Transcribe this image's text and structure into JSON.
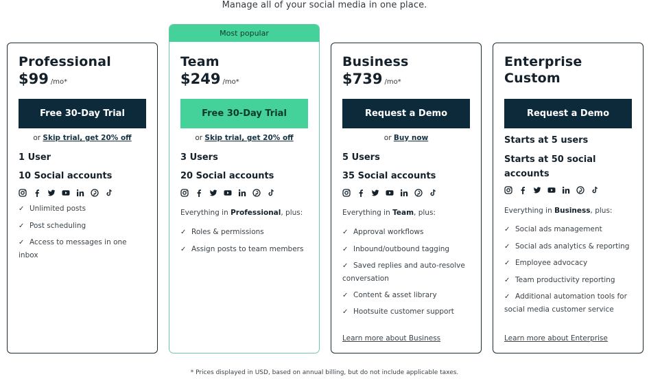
{
  "header": {
    "subtitle": "Manage all of your social media in one place."
  },
  "social_icons": [
    "instagram-icon",
    "facebook-icon",
    "twitter-icon",
    "youtube-icon",
    "linkedin-icon",
    "pinterest-icon",
    "tiktok-icon"
  ],
  "colors": {
    "primary_dark": "#0d2a3b",
    "accent_green": "#45d19a",
    "team_border": "#6fc6a9"
  },
  "plans": [
    {
      "name": "Professional",
      "price": "$99",
      "per": "/mo*",
      "cta": "Free 30-Day Trial",
      "alt_prefix": "or ",
      "alt_link": "Skip trial, get 20% off",
      "users": "1 User",
      "accounts": "10 Social accounts",
      "features": [
        "Unlimited posts",
        "Post scheduling",
        "Access to messages in one inbox"
      ]
    },
    {
      "badge": "Most popular",
      "name": "Team",
      "price": "$249",
      "per": "/mo*",
      "cta": "Free 30-Day Trial",
      "alt_prefix": "or ",
      "alt_link": "Skip trial, get 20% off",
      "users": "3 Users",
      "accounts": "20 Social accounts",
      "intro_prefix": "Everything in ",
      "intro_bold": "Professional",
      "intro_suffix": ", plus:",
      "features": [
        "Roles & permissions",
        "Assign posts to team members"
      ]
    },
    {
      "name": "Business",
      "price": "$739",
      "per": "/mo*",
      "cta": "Request a Demo",
      "alt_prefix": "or ",
      "alt_link": "Buy now",
      "users": "5 Users",
      "accounts": "35 Social accounts",
      "intro_prefix": "Everything in ",
      "intro_bold": "Team",
      "intro_suffix": ", plus:",
      "features": [
        "Approval workflows",
        "Inbound/outbound tagging",
        "Saved replies and auto-resolve conversation",
        "Content & asset library",
        "Hootsuite customer support"
      ],
      "learn_more": "Learn more about Business"
    },
    {
      "name": "Enterprise",
      "price": "Custom",
      "cta": "Request a Demo",
      "users": "Starts at 5 users",
      "accounts": "Starts at 50 social accounts",
      "intro_prefix": "Everything in ",
      "intro_bold": "Business",
      "intro_suffix": ", plus:",
      "features": [
        "Social ads management",
        "Social ads analytics & reporting",
        "Employee advocacy",
        "Team productivity reporting",
        "Additional automation tools for social media customer service"
      ],
      "learn_more": "Learn more about Enterprise"
    }
  ],
  "footnote": "* Prices displayed in USD, based on annual billing, but do not include applicable taxes."
}
